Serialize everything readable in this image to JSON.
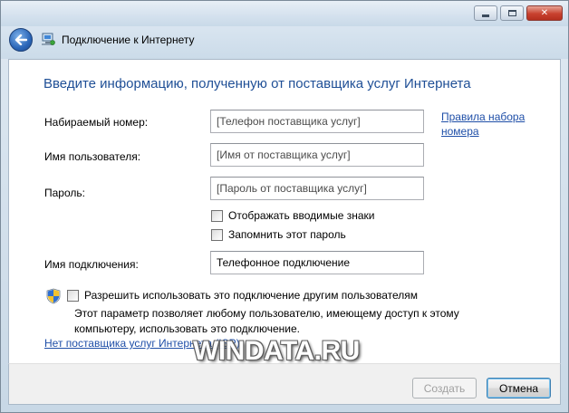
{
  "window": {
    "title": "Подключение к Интернету",
    "controls": [
      "minimize-icon",
      "maximize-icon",
      "close-icon"
    ]
  },
  "main": {
    "heading": "Введите информацию, полученную от поставщика услуг Интернета",
    "fields": {
      "phone": {
        "label": "Набираемый номер:",
        "placeholder": "[Телефон поставщика услуг]"
      },
      "username": {
        "label": "Имя пользователя:",
        "placeholder": "[Имя от поставщика услуг]"
      },
      "password": {
        "label": "Пароль:",
        "placeholder": "[Пароль от поставщика услуг]"
      },
      "connection_name": {
        "label": "Имя подключения:",
        "value": "Телефонное подключение"
      }
    },
    "dialing_rules_link": {
      "line1": "Правила набора",
      "line2": "номера"
    },
    "checkboxes": {
      "show_chars": {
        "label": "Отображать вводимые знаки",
        "checked": false
      },
      "remember_password": {
        "label": "Запомнить этот пароль",
        "checked": false
      },
      "allow_others": {
        "label": "Разрешить использовать это подключение другим пользователям",
        "checked": false
      }
    },
    "allow_description_line1": "Этот параметр позволяет любому пользователю, имеющему доступ к этому",
    "allow_description_line2": "компьютеру, использовать это подключение.",
    "no_isp_link": "Нет поставщика услуг Интернета (ISP)"
  },
  "footer": {
    "create_label": "Создать",
    "cancel_label": "Отмена"
  },
  "watermark": "WINDATA.RU",
  "colors": {
    "heading": "#1f4f96",
    "link": "#1f4fa8",
    "close_button": "#c8412f"
  }
}
